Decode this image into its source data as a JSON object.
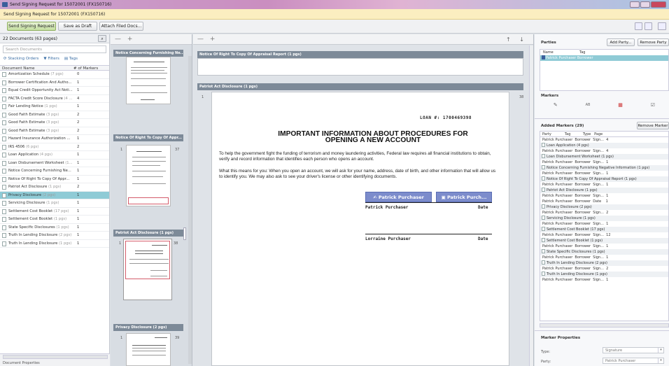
{
  "window": {
    "title": "Send Signing Request for 15072001 (FX150716)"
  },
  "subbar": {
    "title": "Send Signing Request for 15072001 (FX150716)"
  },
  "toolbar": {
    "send": "Send Signing Request",
    "draft": "Save as Draft",
    "attach": "Attach Filed Docs..."
  },
  "documents": {
    "count": "22 Documents (63 pages)",
    "search_placeholder": "Search Documents",
    "stacking": "Stacking Orders",
    "filters": "Filters",
    "tags": "Tags",
    "col_name": "Document Name",
    "col_markers": "# of Markers",
    "items": [
      {
        "name": "Amortization Schedule",
        "pages": "(7 pgs)",
        "markers": "0"
      },
      {
        "name": "Borrower Certification And Autho...",
        "pages": "",
        "markers": "1"
      },
      {
        "name": "Equal Credit Opportunity Act Noti...",
        "pages": "",
        "markers": "1"
      },
      {
        "name": "FACTA Credit Score Disclosure",
        "pages": "(4 ...",
        "markers": "4"
      },
      {
        "name": "Fair Lending Notice",
        "pages": "(1 pgs)",
        "markers": "1"
      },
      {
        "name": "Good Faith Estimate",
        "pages": "(3 pgs)",
        "markers": "2"
      },
      {
        "name": "Good Faith Estimate",
        "pages": "(3 pgs)",
        "markers": "2"
      },
      {
        "name": "Good Faith Estimate",
        "pages": "(3 pgs)",
        "markers": "2"
      },
      {
        "name": "Hazard Insurance Authorization ...",
        "pages": "",
        "markers": "1"
      },
      {
        "name": "IRS 4506",
        "pages": "(6 pgs)",
        "markers": "2"
      },
      {
        "name": "Loan Application",
        "pages": "(4 pgs)",
        "markers": "1"
      },
      {
        "name": "Loan Disbursement Worksheet",
        "pages": "(1...",
        "markers": "1"
      },
      {
        "name": "Notice Concerning Furnishing Ne...",
        "pages": "",
        "markers": "1"
      },
      {
        "name": "Notice Of Right To Copy Of Appr...",
        "pages": "",
        "markers": "1"
      },
      {
        "name": "Patriot Act Disclosure",
        "pages": "(1 pgs)",
        "markers": "2"
      },
      {
        "name": "Privacy Disclosure",
        "pages": "(2 pgs)",
        "markers": "1"
      },
      {
        "name": "Servicing Disclosure",
        "pages": "(1 pgs)",
        "markers": "1"
      },
      {
        "name": "Settlement Cost Booklet",
        "pages": "(17 pgs)",
        "markers": "1"
      },
      {
        "name": "Settlement Cost Booklet",
        "pages": "(1 pgs)",
        "markers": "1"
      },
      {
        "name": "State Specific Disclosures",
        "pages": "(1 pgs)",
        "markers": "1"
      },
      {
        "name": "Truth In Lending Disclosure",
        "pages": "(2 pgs)",
        "markers": "1"
      },
      {
        "name": "Truth In Lending Disclosure",
        "pages": "(1 pgs)",
        "markers": "1"
      }
    ],
    "bottom_label": "Document Properties"
  },
  "thumbnails": {
    "controls": "— +",
    "sections": [
      {
        "title": "Notice Concerning Furnishing Ne..."
      },
      {
        "title": "Notice Of Right To Copy Of Appr...",
        "page_left": "1",
        "page_right": "37"
      },
      {
        "title": "Patriot Act Disclosure (1 pgs)",
        "page_left": "1",
        "page_right": "38"
      },
      {
        "title": "Privacy Disclosure (2 pgs)",
        "page_left": "1",
        "page_right": "39"
      }
    ]
  },
  "viewer": {
    "controls": "— +",
    "arrows": "↑ ↓",
    "section1": "Notice Of Right To Copy Of Appraisal Report (1 pgs)",
    "section2": "Patriot Act Disclosure (1 pgs)",
    "page_left": "1",
    "page_right": "38",
    "loan": "LOAN #: 1700469398",
    "heading1": "IMPORTANT INFORMATION ABOUT PROCEDURES FOR",
    "heading2": "OPENING A NEW ACCOUNT",
    "para1": "To help the government fight the funding of terrorism and money laundering activities, Federal law requires all financial institutions to obtain, verify and record information that identifies each person who opens an account.",
    "para2": "What this means for you: When you open an account, we will ask for your name, address, date of birth, and other information that will allow us to identify you. We may also ask to see your driver's license or other identifying documents.",
    "sig_btn1": "Patrick Purchaser",
    "sig_btn2": "Patrick Purch...",
    "signer1": "Patrick Purchaser",
    "signer2": "Lorraine Purchaser",
    "date": "Date"
  },
  "parties": {
    "title": "Parties",
    "add": "Add Party...",
    "remove": "Remove Party",
    "col_name": "Name",
    "col_tag": "Tag",
    "row_name": "Patrick Purchaser",
    "row_tag": "Borrower"
  },
  "markers": {
    "title": "Markers",
    "icons": [
      "signature-icon",
      "initials-icon",
      "date-icon",
      "checkbox-icon"
    ]
  },
  "added_markers": {
    "title": "Added Markers (29)",
    "remove": "Remove Marker",
    "header": "Party            Tag           Type   Page",
    "rows": [
      {
        "kind": "row",
        "text": "Patrick Purchaser  Borrower  Sign...  4"
      },
      {
        "kind": "doc",
        "text": "Loan Application (4 pgs)"
      },
      {
        "kind": "row",
        "text": "Patrick Purchaser  Borrower  Sign...  4"
      },
      {
        "kind": "doc",
        "text": "Loan Disbursement Worksheet (1 pgs)"
      },
      {
        "kind": "row",
        "text": "Patrick Purchaser  Borrower  Sign...  1"
      },
      {
        "kind": "doc",
        "text": "Notice Concerning Furnishing Negative Information (1 pgs)"
      },
      {
        "kind": "row",
        "text": "Patrick Purchaser  Borrower  Sign...  1"
      },
      {
        "kind": "doc",
        "text": "Notice Of Right To Copy Of Appraisal Report (1 pgs)"
      },
      {
        "kind": "row",
        "text": "Patrick Purchaser  Borrower  Sign...  1"
      },
      {
        "kind": "doc",
        "text": "Patriot Act Disclosure (1 pgs)"
      },
      {
        "kind": "row",
        "text": "Patrick Purchaser  Borrower  Sign...  1"
      },
      {
        "kind": "row",
        "text": "Patrick Purchaser  Borrower  Date    1"
      },
      {
        "kind": "doc",
        "text": "Privacy Disclosure (2 pgs)"
      },
      {
        "kind": "row",
        "text": "Patrick Purchaser  Borrower  Sign...  2"
      },
      {
        "kind": "doc",
        "text": "Servicing Disclosure (1 pgs)"
      },
      {
        "kind": "row",
        "text": "Patrick Purchaser  Borrower  Sign...  1"
      },
      {
        "kind": "doc",
        "text": "Settlement Cost Booklet (17 pgs)"
      },
      {
        "kind": "row",
        "text": "Patrick Purchaser  Borrower  Sign...  12"
      },
      {
        "kind": "doc",
        "text": "Settlement Cost Booklet (1 pgs)"
      },
      {
        "kind": "row",
        "text": "Patrick Purchaser  Borrower  Sign...  1"
      },
      {
        "kind": "doc",
        "text": "State Specific Disclosures (1 pgs)"
      },
      {
        "kind": "row",
        "text": "Patrick Purchaser  Borrower  Sign...  1"
      },
      {
        "kind": "doc",
        "text": "Truth In Lending Disclosure (2 pgs)"
      },
      {
        "kind": "row",
        "text": "Patrick Purchaser  Borrower  Sign...  2"
      },
      {
        "kind": "doc",
        "text": "Truth In Lending Disclosure (1 pgs)"
      },
      {
        "kind": "row",
        "text": "Patrick Purchaser  Borrower  Sign...  1"
      }
    ]
  },
  "marker_properties": {
    "title": "Marker Properties",
    "type_label": "Type:",
    "type_value": "Signature",
    "party_label": "Party:",
    "party_value": "Patrick Purchaser"
  },
  "colors": {
    "selected_row": "#8fcbd6",
    "section_header": "#7d8a98",
    "sig_button": "#7c8ccc",
    "subbar": "#fbeec0"
  }
}
